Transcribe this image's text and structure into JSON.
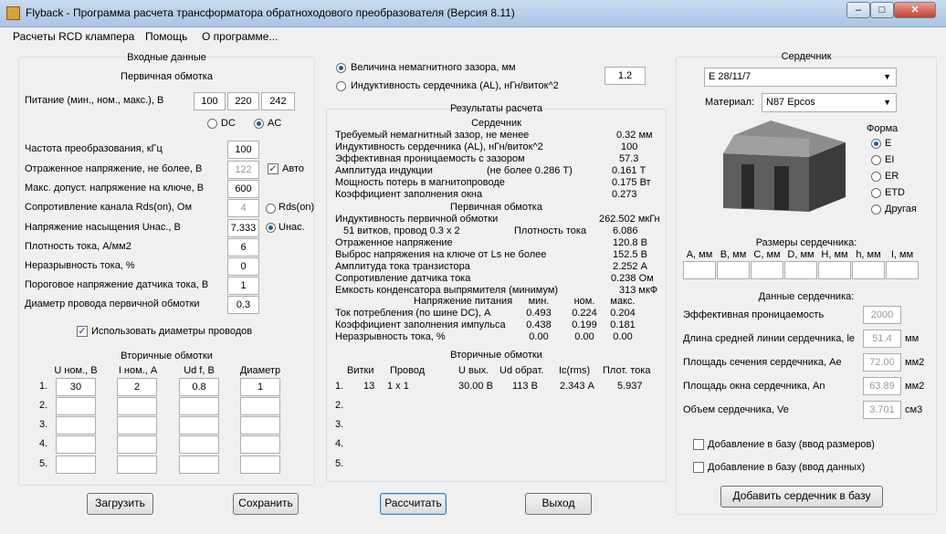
{
  "window": {
    "title": "Flyback - Программа расчета трансформатора обратноходового преобразователя (Версия 8.11)"
  },
  "menu": [
    "Расчеты RCD клампера",
    "Помощь",
    "О программе..."
  ],
  "input": {
    "title": "Входные данные",
    "primary_title": "Первичная обмотка",
    "supply_label": "Питание (мин., ном., макс.), В",
    "supply_values": [
      "100",
      "220",
      "242"
    ],
    "dc_label": "DC",
    "ac_label": "AC",
    "freq_label": "Частота преобразования, кГц",
    "freq": "100",
    "reflected_label": "Отраженное напряжение, не более, В",
    "reflected": "122",
    "auto_label": "Авто",
    "vmax_label": "Макс. допуст. напряжение на ключе, В",
    "vmax": "600",
    "rds_label": "Сопротивление канала Rds(on), Ом",
    "rds": "4",
    "rds_radio": "Rds(on)",
    "usat_label": "Напряжение насыщения Uнас., В",
    "usat": "7.333",
    "usat_radio": "Uнас.",
    "jdens_label": "Плотность тока, А/мм2",
    "jdens": "6",
    "cont_label": "Неразрывность тока, %",
    "cont": "0",
    "ithr_label": "Пороговое напряжение датчика тока, В",
    "ithr": "1",
    "wire_label": "Диаметр провода первичной обмотки",
    "wire": "0.3",
    "use_diam_label": "Использовать диаметры проводов",
    "secondary_title": "Вторичные обмотки",
    "sec_headers": [
      "U ном., В",
      "I ном., А",
      "Ud f, В",
      "Диаметр"
    ],
    "sec_rows": [
      {
        "n": "1.",
        "u": "30",
        "i": "2",
        "ud": "0.8",
        "d": "1"
      },
      {
        "n": "2.",
        "u": "",
        "i": "",
        "ud": "",
        "d": ""
      },
      {
        "n": "3.",
        "u": "",
        "i": "",
        "ud": "",
        "d": ""
      },
      {
        "n": "4.",
        "u": "",
        "i": "",
        "ud": "",
        "d": ""
      },
      {
        "n": "5.",
        "u": "",
        "i": "",
        "ud": "",
        "d": ""
      }
    ]
  },
  "mode": {
    "gap_label": "Величина немагнитного зазора, мм",
    "al_label": "Индуктивность сердечника (AL), нГн/виток^2",
    "value": "1.2"
  },
  "results": {
    "title": "Результаты расчета",
    "core_title": "Сердечник",
    "core_rows": [
      {
        "label": "Требуемый немагнитный зазор, не менее",
        "value": "0.32 мм"
      },
      {
        "label": "Индуктивность сердечника (AL), нГн/виток^2",
        "value": "100"
      },
      {
        "label": "Эффективная проницаемость с зазором",
        "value": "57.3"
      },
      {
        "label": "Амплитуда индукции",
        "extra": "(не более 0.286 Т)",
        "value": "0.161 Т"
      },
      {
        "label": "Мощность потерь в магнитопроводе",
        "value": "0.175 Вт"
      },
      {
        "label": "Коэффициент заполнения окна",
        "value": "0.273"
      }
    ],
    "primary_title": "Первичная обмотка",
    "prim_rows": [
      {
        "label": "Индуктивность первичной обмотки",
        "value": "262.502 мкГн"
      },
      {
        "label": "51 витков, провод 0.3 х 2",
        "extra": "Плотность тока",
        "value": "6.086"
      },
      {
        "label": "Отраженное напряжение",
        "value": "120.8 В"
      },
      {
        "label": "Выброс напряжения на ключе от Ls не более",
        "value": "152.5 В"
      },
      {
        "label": "Амплитуда тока транзистора",
        "value": "2.252 А"
      },
      {
        "label": "Сопротивление датчика тока",
        "value": "0.238 Ом"
      },
      {
        "label": "Емкость конденсатора выпрямителя (минимум)",
        "value": "313 мкФ"
      }
    ],
    "supply_hdr": [
      "Напряжение питания",
      "мин.",
      "ном.",
      "макс."
    ],
    "supply_rows": [
      {
        "label": "Ток потребления (по шине DC), А",
        "v": [
          "0.493",
          "0.224",
          "0.204"
        ]
      },
      {
        "label": "Коэффициент заполнения импульса",
        "v": [
          "0.438",
          "0.199",
          "0.181"
        ]
      },
      {
        "label": "Неразрывность тока, %",
        "v": [
          "0.00",
          "0.00",
          "0.00"
        ]
      }
    ],
    "sec_title": "Вторичные обмотки",
    "sec_hdr": [
      "Витки",
      "Провод",
      "U вых.",
      "Ud обрат.",
      "Ic(rms)",
      "Плот. тока"
    ],
    "sec_rows": [
      {
        "n": "1.",
        "v": [
          "13",
          "1 х 1",
          "30.00 В",
          "113 В",
          "2.343 А",
          "5.937"
        ]
      },
      {
        "n": "2.",
        "v": [
          "",
          "",
          "",
          "",
          "",
          ""
        ]
      },
      {
        "n": "3.",
        "v": [
          "",
          "",
          "",
          "",
          "",
          ""
        ]
      },
      {
        "n": "4.",
        "v": [
          "",
          "",
          "",
          "",
          "",
          ""
        ]
      },
      {
        "n": "5.",
        "v": [
          "",
          "",
          "",
          "",
          "",
          ""
        ]
      }
    ]
  },
  "core": {
    "title": "Сердечник",
    "core_value": "E 28/11/7",
    "material_label": "Материал:",
    "material_value": "N87 Epcos",
    "shape_title": "Форма",
    "shapes": [
      "E",
      "EI",
      "ER",
      "ETD",
      "Другая"
    ],
    "dims_title": "Размеры сердечника:",
    "dims": [
      "A, мм",
      "B, мм",
      "C, мм",
      "D, мм",
      "H, мм",
      "h, мм",
      "I, мм"
    ],
    "data_title": "Данные сердечника:",
    "data_rows": [
      {
        "label": "Эффективная проницаемость",
        "value": "2000",
        "unit": ""
      },
      {
        "label": "Длина средней линии сердечника, le",
        "value": "51.4",
        "unit": "мм"
      },
      {
        "label": "Площадь сечения сердечника, Ae",
        "value": "72.00",
        "unit": "мм2"
      },
      {
        "label": "Площадь окна сердечника, An",
        "value": "63.89",
        "unit": "мм2"
      },
      {
        "label": "Объем сердечника, Ve",
        "value": "3.701",
        "unit": "см3"
      }
    ],
    "add_dims": "Добавление в базу (ввод размеров)",
    "add_data": "Добавление в базу (ввод данных)",
    "add_button": "Добавить сердечник в базу"
  },
  "buttons": {
    "load": "Загрузить",
    "save": "Сохранить",
    "calc": "Рассчитать",
    "exit": "Выход"
  }
}
